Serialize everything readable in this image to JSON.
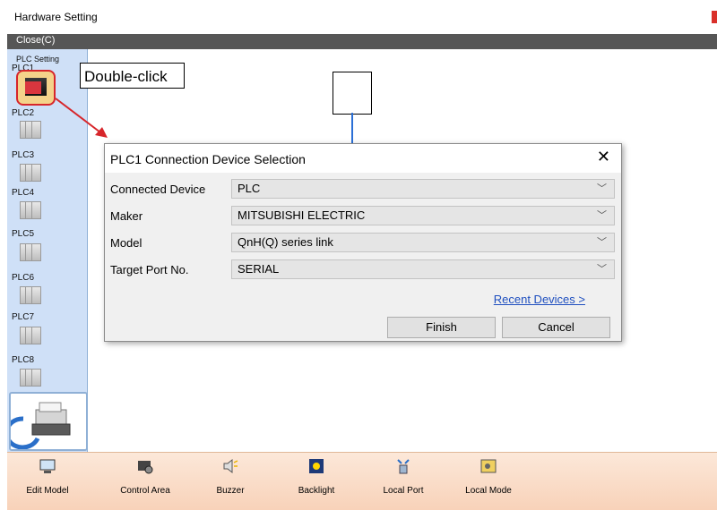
{
  "window": {
    "title": "Hardware Setting"
  },
  "menubar": {
    "close_label": "Close(C)"
  },
  "sidebar": {
    "header": "PLC Setting",
    "items": [
      {
        "label": "PLC1"
      },
      {
        "label": "PLC2"
      },
      {
        "label": "PLC3"
      },
      {
        "label": "PLC4"
      },
      {
        "label": "PLC5"
      },
      {
        "label": "PLC6"
      },
      {
        "label": "PLC7"
      },
      {
        "label": "PLC8"
      }
    ]
  },
  "callout": {
    "text": "Double-click"
  },
  "dialog": {
    "title": "PLC1 Connection Device Selection",
    "rows": [
      {
        "label": "Connected Device",
        "value": "PLC"
      },
      {
        "label": "Maker",
        "value": "MITSUBISHI ELECTRIC"
      },
      {
        "label": "Model",
        "value": "QnH(Q) series link"
      },
      {
        "label": "Target Port No.",
        "value": "SERIAL"
      }
    ],
    "recent_link": "Recent Devices >",
    "finish_label": "Finish",
    "cancel_label": "Cancel"
  },
  "toolbar": {
    "items": [
      {
        "label": "Edit Model",
        "icon": "monitor-icon"
      },
      {
        "label": "Control Area",
        "icon": "control-area-icon"
      },
      {
        "label": "Buzzer",
        "icon": "speaker-icon"
      },
      {
        "label": "Backlight",
        "icon": "backlight-icon"
      },
      {
        "label": "Local Port",
        "icon": "network-port-icon"
      },
      {
        "label": "Local Mode",
        "icon": "local-mode-icon"
      }
    ]
  },
  "colors": {
    "accent_red": "#d7262b",
    "sidebar_bg": "#cfe0f7",
    "toolbar_bg": "#f8d2b9"
  }
}
